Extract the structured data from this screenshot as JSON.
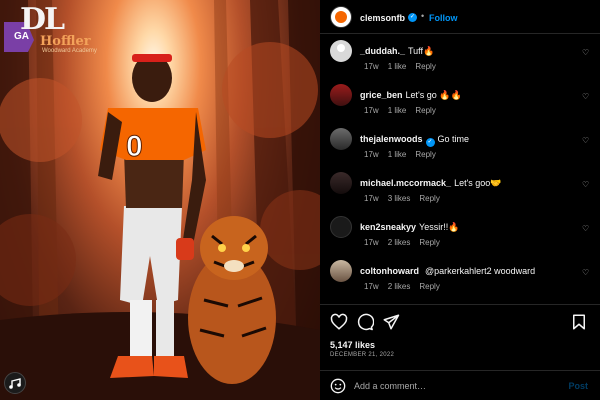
{
  "post_image": {
    "badge": {
      "initials": "DL",
      "state": "GA",
      "last_name": "Hoffler",
      "school": "Woodward Academy"
    },
    "jersey_number": "0"
  },
  "header": {
    "username": "clemsonfb",
    "separator": "•",
    "follow_label": "Follow"
  },
  "comments": [
    {
      "username": "_duddah._",
      "text": "Tuff🔥",
      "time": "17w",
      "likes": "1 like",
      "reply": "Reply",
      "verified": false
    },
    {
      "username": "grice_ben",
      "text": "Let's go 🔥🔥",
      "time": "17w",
      "likes": "1 like",
      "reply": "Reply",
      "verified": false
    },
    {
      "username": "thejalenwoods",
      "text": "Go time",
      "time": "17w",
      "likes": "1 like",
      "reply": "Reply",
      "verified": true
    },
    {
      "username": "michael.mccormack_",
      "text": "Let's goo🤝",
      "time": "17w",
      "likes": "3 likes",
      "reply": "Reply",
      "verified": false
    },
    {
      "username": "ken2sneakyy",
      "text": "Yessir!!🔥",
      "time": "17w",
      "likes": "2 likes",
      "reply": "Reply",
      "verified": false
    },
    {
      "username": "coltonhoward",
      "text": "@parkerkahlert2 woodward",
      "time": "17w",
      "likes": "2 likes",
      "reply": "Reply",
      "verified": false
    }
  ],
  "likes_count": "5,147 likes",
  "date": "DECEMBER 21, 2022",
  "add_comment": {
    "placeholder": "Add a comment…",
    "post_label": "Post"
  },
  "icons": {
    "verified": "verified-badge-icon",
    "like": "heart-icon",
    "comment": "comment-bubble-icon",
    "share": "paper-plane-icon",
    "save": "bookmark-icon",
    "emoji": "smiley-icon"
  },
  "colors": {
    "accent": "#0095f6",
    "clemson_orange": "#f56600",
    "background": "#000000",
    "muted": "#a8a8a8"
  }
}
